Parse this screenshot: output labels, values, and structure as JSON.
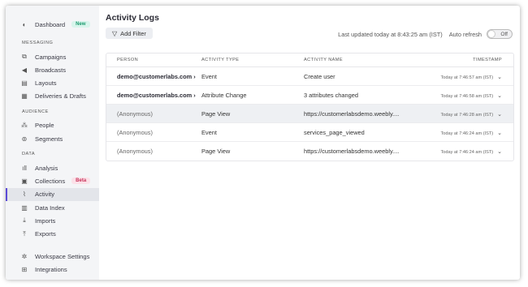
{
  "sidebar": {
    "dashboard": {
      "label": "Dashboard",
      "badge": "New",
      "icon": "dashboard-icon"
    },
    "sections": [
      {
        "label": "MESSAGING",
        "items": [
          {
            "label": "Campaigns",
            "icon": "campaigns-icon"
          },
          {
            "label": "Broadcasts",
            "icon": "megaphone-icon"
          },
          {
            "label": "Layouts",
            "icon": "layouts-icon"
          },
          {
            "label": "Deliveries & Drafts",
            "icon": "document-icon"
          }
        ]
      },
      {
        "label": "AUDIENCE",
        "items": [
          {
            "label": "People",
            "icon": "people-icon"
          },
          {
            "label": "Segments",
            "icon": "segments-icon"
          }
        ]
      },
      {
        "label": "DATA",
        "items": [
          {
            "label": "Analysis",
            "icon": "chart-icon"
          },
          {
            "label": "Collections",
            "badge": "Beta",
            "icon": "collections-icon"
          },
          {
            "label": "Activity",
            "icon": "activity-icon",
            "active": true
          },
          {
            "label": "Data Index",
            "icon": "data-index-icon"
          },
          {
            "label": "Imports",
            "icon": "import-icon"
          },
          {
            "label": "Exports",
            "icon": "export-icon"
          }
        ]
      }
    ],
    "footer": [
      {
        "label": "Workspace Settings",
        "icon": "gear-icon"
      },
      {
        "label": "Integrations",
        "icon": "integrations-icon"
      }
    ]
  },
  "main": {
    "title": "Activity Logs",
    "add_filter": "Add Filter",
    "last_updated": "Last updated today at 8:43:25 am (IST)",
    "auto_refresh_label": "Auto refresh",
    "auto_refresh_state": "Off"
  },
  "table": {
    "headers": [
      "PERSON",
      "ACTIVITY TYPE",
      "ACTIVITY NAME",
      "TIMESTAMP"
    ],
    "rows": [
      {
        "person": "demo@customerlabs.com ›",
        "type": "Event",
        "name": "Create user",
        "time": "Today at 7:46:57 am (IST)"
      },
      {
        "person": "demo@customerlabs.com ›",
        "type": "Attribute Change",
        "name": "3 attributes changed",
        "time": "Today at 7:46:58 am (IST)"
      },
      {
        "person": "(Anonymous)",
        "type": "Page View",
        "name": "https://customerlabsdemo.weebly....",
        "time": "Today at 7:46:28 am (IST)"
      },
      {
        "person": "(Anonymous)",
        "type": "Event",
        "name": "services_page_viewed",
        "time": "Today at 7:46:24 am (IST)"
      },
      {
        "person": "(Anonymous)",
        "type": "Page View",
        "name": "https://customerlabsdemo.weebly....",
        "time": "Today at 7:46:24 am (IST)"
      }
    ]
  },
  "colors": {
    "accent": "#5b4ad6",
    "new_badge": "#1b9a6e",
    "beta_badge": "#c8325a"
  }
}
